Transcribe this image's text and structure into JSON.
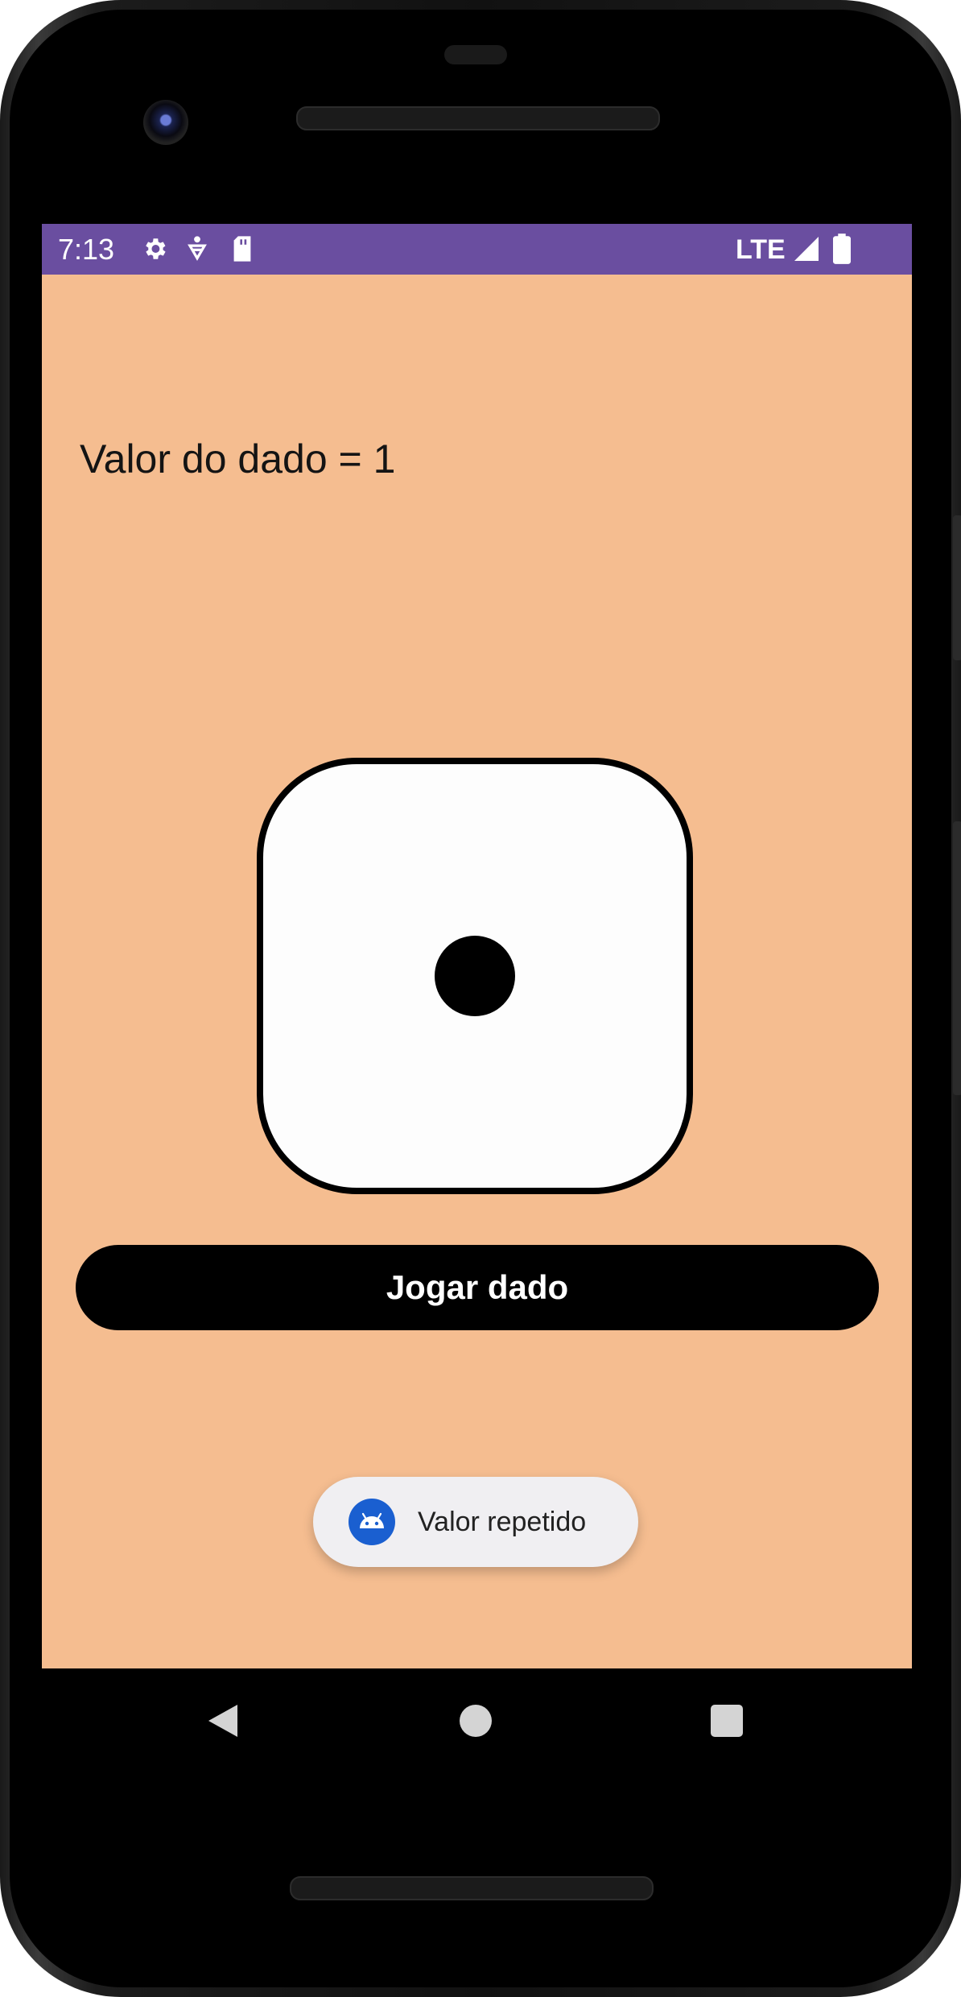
{
  "status_bar": {
    "time": "7:13",
    "network": "LTE",
    "left_icons": [
      "gear-icon",
      "accessibility-icon",
      "sd-card-icon"
    ],
    "right_icons": [
      "signal-icon",
      "battery-icon"
    ],
    "color": "#6a4ea0"
  },
  "main": {
    "value_text": "Valor do dado = 1",
    "die_value": 1,
    "roll_button_label": "Jogar dado",
    "background": "#f5bd90"
  },
  "toast": {
    "text": "Valor repetido",
    "icon": "android-icon"
  },
  "nav_bar": {
    "buttons": [
      "back-icon",
      "home-icon",
      "recents-icon"
    ]
  }
}
